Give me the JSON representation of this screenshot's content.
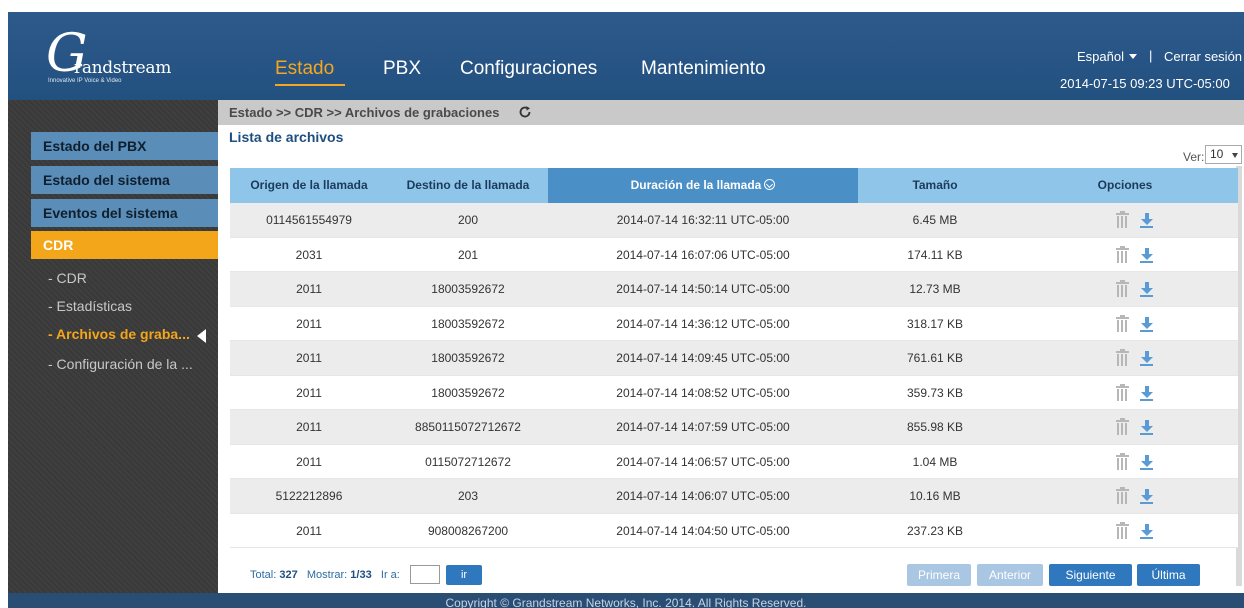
{
  "brand": {
    "logo_word": "Grandstream",
    "tagline": "Innovative IP Voice & Video"
  },
  "topnav": {
    "items": [
      "Estado",
      "PBX",
      "Configuraciones",
      "Mantenimiento"
    ],
    "active": "Estado"
  },
  "header": {
    "language": "Español",
    "separator": "|",
    "logout": "Cerrar sesión",
    "datetime": "2014-07-15 09:23 UTC-05:00"
  },
  "sidebar": {
    "sections": [
      "Estado del PBX",
      "Estado del sistema",
      "Eventos del sistema",
      "CDR"
    ],
    "active_section": "CDR",
    "sub_items": [
      "- CDR",
      "- Estadísticas",
      "- Archivos de graba...",
      "- Configuración de la ..."
    ],
    "active_sub_item": "- Archivos de graba..."
  },
  "breadcrumb": "Estado >> CDR >> Archivos de grabaciones",
  "list_title": "Lista de archivos",
  "view": {
    "label": "Ver:",
    "value": "10"
  },
  "table": {
    "headers": [
      "Origen de la llamada",
      "Destino de la llamada",
      "Duración de la llamada",
      "Tamaño",
      "Opciones"
    ],
    "sorted_column": "Duración de la llamada",
    "rows": [
      {
        "origen": "0114561554979",
        "destino": "200",
        "duracion": "2014-07-14 16:32:11 UTC-05:00",
        "tamano": "6.45 MB"
      },
      {
        "origen": "2031",
        "destino": "201",
        "duracion": "2014-07-14 16:07:06 UTC-05:00",
        "tamano": "174.11 KB"
      },
      {
        "origen": "2011",
        "destino": "18003592672",
        "duracion": "2014-07-14 14:50:14 UTC-05:00",
        "tamano": "12.73 MB"
      },
      {
        "origen": "2011",
        "destino": "18003592672",
        "duracion": "2014-07-14 14:36:12 UTC-05:00",
        "tamano": "318.17 KB"
      },
      {
        "origen": "2011",
        "destino": "18003592672",
        "duracion": "2014-07-14 14:09:45 UTC-05:00",
        "tamano": "761.61 KB"
      },
      {
        "origen": "2011",
        "destino": "18003592672",
        "duracion": "2014-07-14 14:08:52 UTC-05:00",
        "tamano": "359.73 KB"
      },
      {
        "origen": "2011",
        "destino": "8850115072712672",
        "duracion": "2014-07-14 14:07:59 UTC-05:00",
        "tamano": "855.98 KB"
      },
      {
        "origen": "2011",
        "destino": "0115072712672",
        "duracion": "2014-07-14 14:06:57 UTC-05:00",
        "tamano": "1.04 MB"
      },
      {
        "origen": "5122212896",
        "destino": "203",
        "duracion": "2014-07-14 14:06:07 UTC-05:00",
        "tamano": "10.16 MB"
      },
      {
        "origen": "2011",
        "destino": "908008267200",
        "duracion": "2014-07-14 14:04:50 UTC-05:00",
        "tamano": "237.23 KB"
      }
    ],
    "row_actions": [
      "trash-icon",
      "download-icon"
    ]
  },
  "pager": {
    "total_label": "Total:",
    "total": "327",
    "show_label": "Mostrar:",
    "show": "1/33",
    "goto_label": "Ir a:",
    "goto_value": "",
    "goto_button": "ir",
    "first": "Primera",
    "prev": "Anterior",
    "next": "Siguiente",
    "last": "Última"
  },
  "footer": {
    "copyright": "Copyright © Grandstream Networks, Inc. 2014. All Rights Reserved."
  },
  "colors": {
    "header_bg": "#2d5a8b",
    "accent": "#f4a61b",
    "table_header": "#8fc5e8",
    "sorted_header": "#4a8fc6",
    "button": "#2f78bd"
  }
}
